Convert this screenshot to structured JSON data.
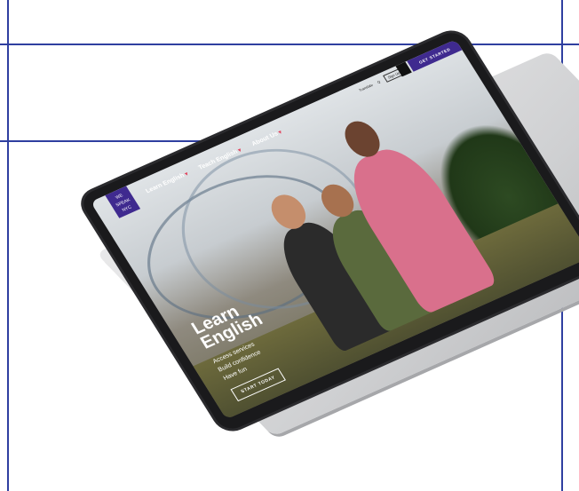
{
  "top_banner": {
    "text": ""
  },
  "site": {
    "logo_text": "WE SPEAK NYC",
    "nav": [
      {
        "label": "Learn English"
      },
      {
        "label": "Teach English"
      },
      {
        "label": "About Us"
      }
    ],
    "utility": {
      "translate": "Translate",
      "search": "Q",
      "signup": "Sign Up"
    },
    "cta": "GET STARTED"
  },
  "hero": {
    "title": "Learn English",
    "list": [
      "Access services",
      "Build confidence",
      "Have fun"
    ],
    "button": "START TODAY"
  }
}
